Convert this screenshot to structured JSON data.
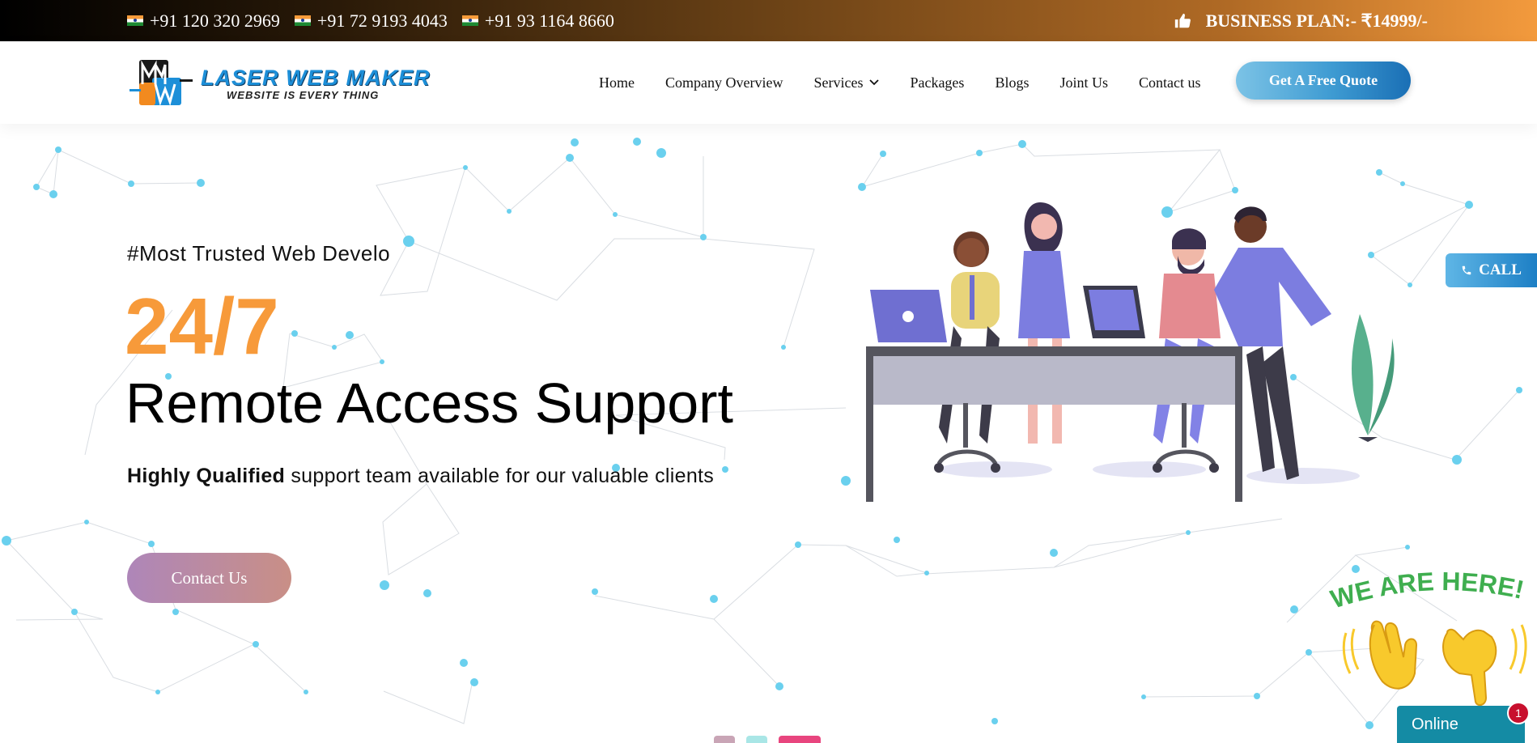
{
  "topbar": {
    "phones": [
      "+91 120 320 2969",
      "+91 72 9193 4043",
      "+91 93 1164 8660"
    ],
    "business_plan": "BUSINESS PLAN:- ₹14999/-",
    "icon": "thumbs-up-icon"
  },
  "logo": {
    "title": "LASER WEB MAKER",
    "tagline": "WEBSITE IS EVERY THING"
  },
  "nav": {
    "items": [
      "Home",
      "Company Overview",
      "Services",
      "Packages",
      "Blogs",
      "Joint Us",
      "Contact us"
    ],
    "quote_button": "Get A Free Quote"
  },
  "hero": {
    "hashtag": "#Most Trusted Web Develo",
    "headline_number": "24/7",
    "headline": "Remote Access Support",
    "sub_bold": "Highly Qualified",
    "sub_rest": " support team available for our valuable clients",
    "button": "Contact Us"
  },
  "floating": {
    "call_label": "CALL",
    "we_are_here": "WE ARE HERE!",
    "chat_status": "Online",
    "chat_badge": "1"
  },
  "colors": {
    "accent_orange": "#f79a3a",
    "accent_blue": "#1d7fc5",
    "chat_teal": "#148ba4"
  }
}
